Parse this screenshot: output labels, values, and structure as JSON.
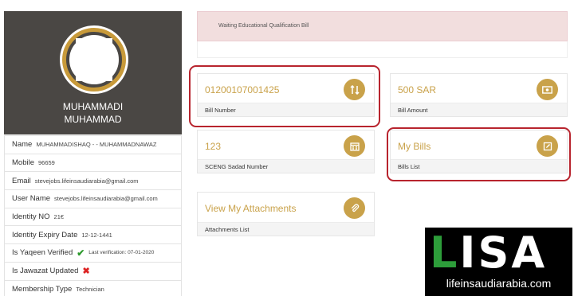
{
  "profile": {
    "name_line1": "MUHAMMADI",
    "name_line2": "MUHAMMAD"
  },
  "info": {
    "name_label": "Name",
    "name_value": "MUHAMMADISHAQ - - MUHAMMADNAWAZ",
    "mobile_label": "Mobile",
    "mobile_value": "96659",
    "email_label": "Email",
    "email_value": "stevejobs.lifeinsaudiarabia@gmail.com",
    "username_label": "User Name",
    "username_value": "stevejobs.lifeinsaudiarabia@gmail.com",
    "identity_label": "Identity NO",
    "identity_value": "21€",
    "expiry_label": "Identity Expiry Date",
    "expiry_value": "12-12-1441",
    "yaqeen_label": "Is Yaqeen Verified",
    "yaqeen_check": "✔",
    "yaqeen_note": "Last verification: 07-01-2020",
    "jawazat_label": "Is Jawazat Updated",
    "jawazat_x": "✖",
    "membership_label": "Membership Type",
    "membership_value": "Technician"
  },
  "alert": {
    "text": "Waiting Educational Qualification Bill"
  },
  "cards": {
    "bill_number_value": "01200107001425",
    "bill_number_label": "Bill Number",
    "bill_amount_value": "500 SAR",
    "bill_amount_label": "Bill Amount",
    "sadad_value": "123",
    "sadad_label": "SCENG Sadad Number",
    "my_bills_value": "My Bills",
    "my_bills_label": "Bills List",
    "attachments_value": "View My Attachments",
    "attachments_label": "Attachments List"
  },
  "icons": {
    "bill_number": "sort-arrows-icon",
    "bill_amount": "money-icon",
    "sadad": "calendar-icon",
    "my_bills": "edit-icon",
    "attachments": "paperclip-icon"
  },
  "logo": {
    "word_l": "L",
    "word_rest": "ISA",
    "url": "lifeinsaudiarabia.com"
  },
  "colors": {
    "accent": "#c9a24a",
    "highlight": "#b8242e",
    "alert_bg": "#f2dede",
    "profile_bg": "#4a4744"
  }
}
